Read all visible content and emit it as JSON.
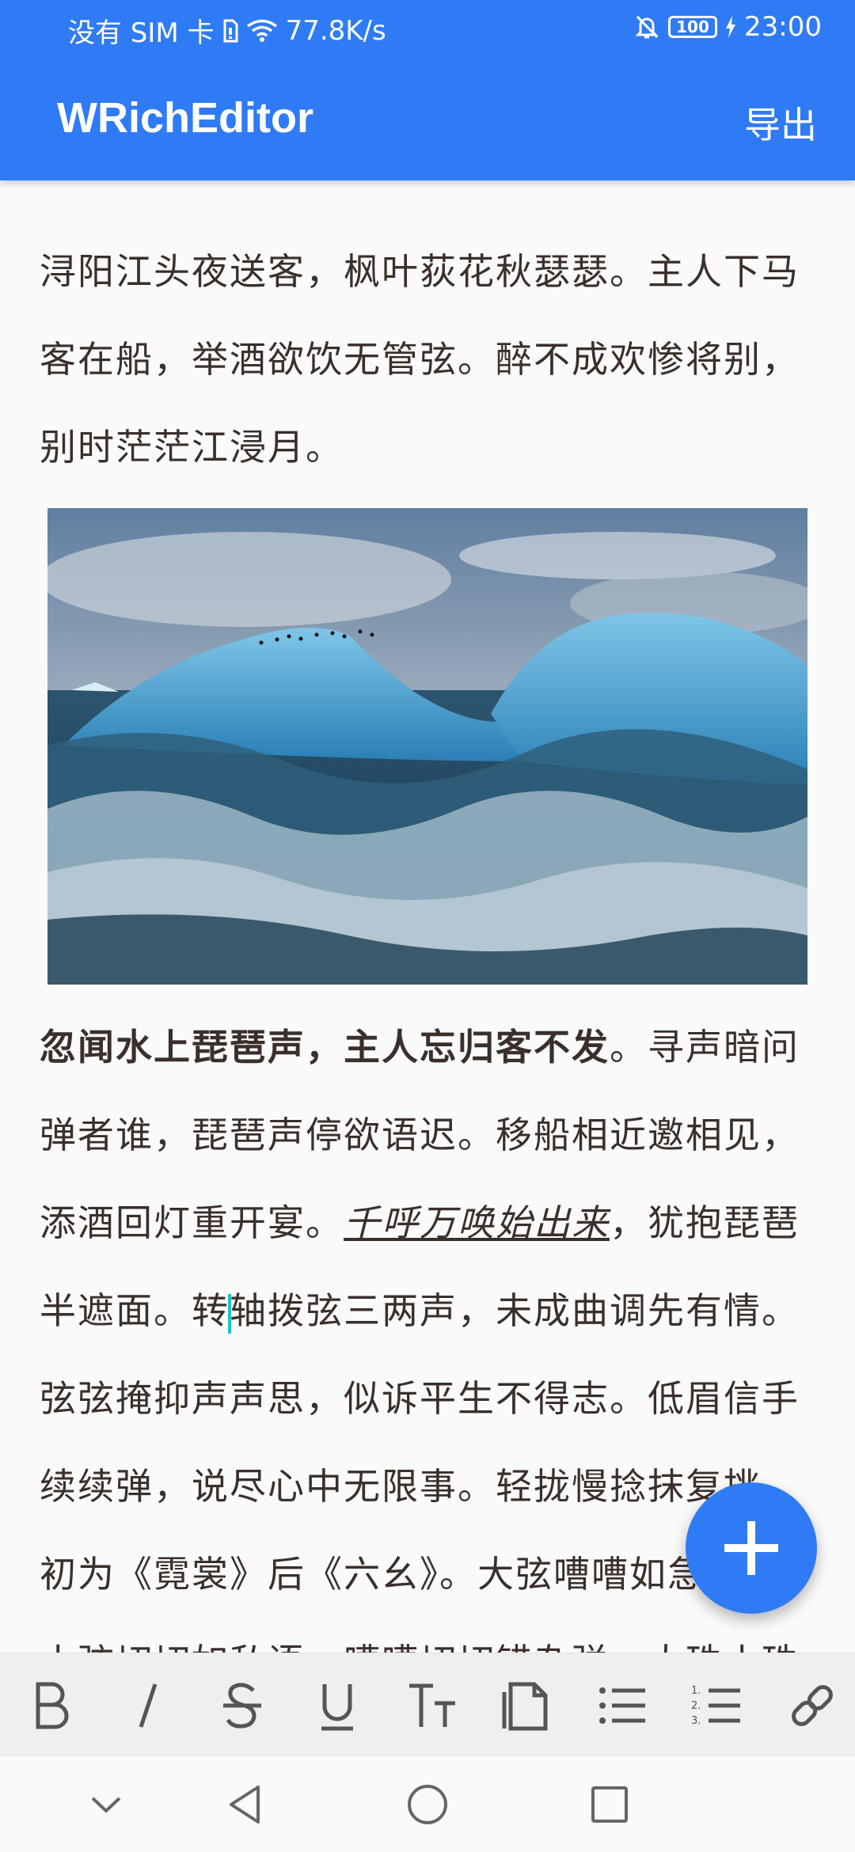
{
  "status_bar": {
    "carrier": "没有 SIM 卡",
    "network_speed": "77.8K/s",
    "battery_level": "100",
    "time": "23:00"
  },
  "app_bar": {
    "title": "WRichEditor",
    "export_label": "导出"
  },
  "editor": {
    "paragraph_1": "浔阳江头夜送客，枫叶荻花秋瑟瑟。主人下马客在船，举酒欲饮无管弦。醉不成欢惨将别，别时茫茫江浸月。",
    "paragraph_2": {
      "bold": "忽闻水上琵琶声，主人忘归客不发",
      "after_bold": "。寻声暗问弹者谁，琵琶声停欲语迟。移船相近邀相见，添酒回灯重开宴。",
      "italic_underline": "千呼万唤始出来",
      "after_italic": "，犹抱琵琶半遮面。转",
      "after_cursor": "轴拨弦三两声，未成曲调先有情。弦弦掩抑声声思，似诉平生不得志。低眉信手续续弹，说尽心中无限事。轻拢慢捻抹复挑，初为《霓裳》后《六幺》。大弦嘈嘈如急雨，小弦切切如私语。嘈嘈切切错杂弹，大珠小珠"
    },
    "image_icon": "iceberg-photo"
  },
  "toolbar": {
    "items": [
      "bold-icon",
      "italic-icon",
      "strikethrough-icon",
      "underline-icon",
      "text-size-icon",
      "file-icon",
      "bullet-list-icon",
      "numbered-list-icon",
      "link-icon"
    ]
  },
  "colors": {
    "primary": "#2f7bf5",
    "text": "#3b2f2a",
    "cursor": "#1cc4c0"
  }
}
